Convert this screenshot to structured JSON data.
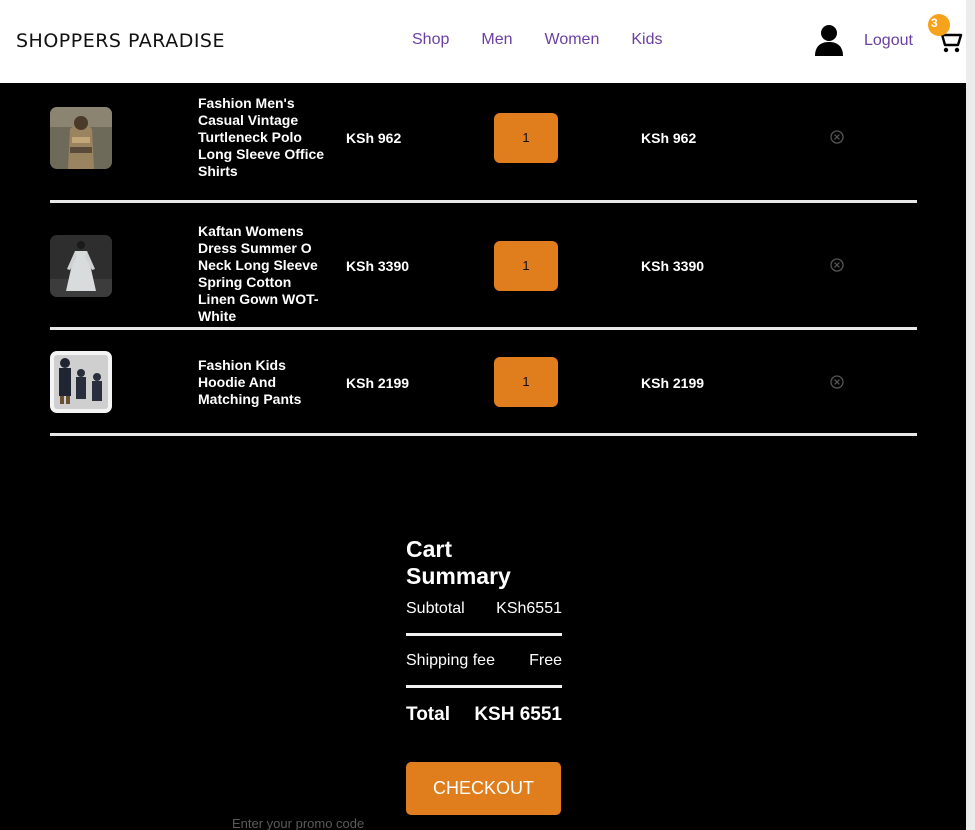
{
  "header": {
    "brand": "SHOPPERS PARADISE",
    "nav": [
      "Shop",
      "Men",
      "Women",
      "Kids"
    ],
    "logout_label": "Logout",
    "cart_count": "3"
  },
  "cart": {
    "items": [
      {
        "name": "Fashion Men's Casual Vintage Turtleneck Polo Long Sleeve Office Shirts",
        "price": "KSh 962",
        "qty": "1",
        "total": "KSh 962"
      },
      {
        "name": "Kaftan Womens Dress Summer O Neck Long Sleeve Spring Cotton Linen Gown WOT-White",
        "price": "KSh 3390",
        "qty": "1",
        "total": "KSh 3390"
      },
      {
        "name": "Fashion Kids Hoodie And Matching Pants",
        "price": "KSh 2199",
        "qty": "1",
        "total": "KSh 2199"
      }
    ]
  },
  "summary": {
    "title": "Cart Summary",
    "subtotal_label": "Subtotal",
    "subtotal_value": "KSh6551",
    "shipping_label": "Shipping fee",
    "shipping_value": "Free",
    "total_label": "Total",
    "total_value": "KSH 6551",
    "checkout_label": "CHECKOUT",
    "promo_placeholder": "Enter your promo code"
  },
  "colors": {
    "accent": "#e07d1d",
    "nav_link": "#6b3fa0",
    "badge": "#f7a21b",
    "background": "#000000"
  }
}
